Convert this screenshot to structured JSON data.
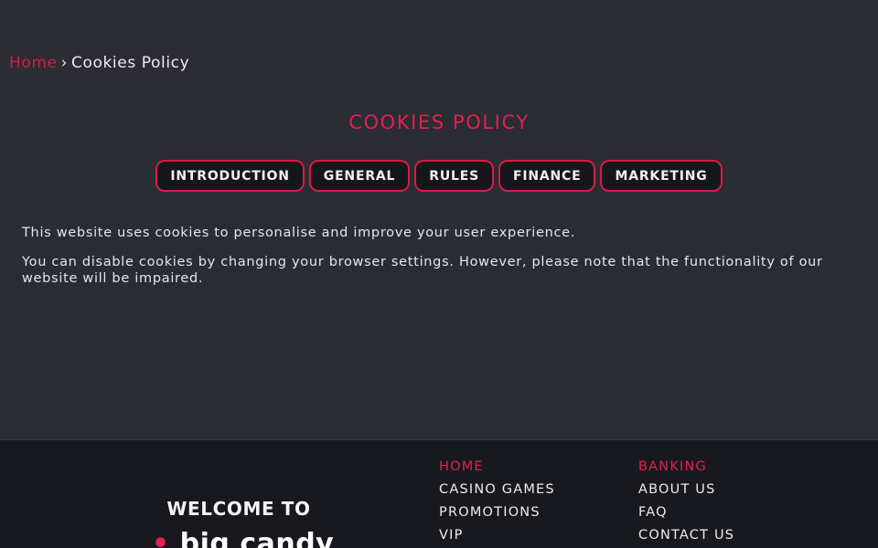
{
  "breadcrumb": {
    "home": "Home",
    "separator": "›",
    "current": "Cookies Policy"
  },
  "page_title": "COOKIES POLICY",
  "tabs": [
    {
      "label": "INTRODUCTION"
    },
    {
      "label": "GENERAL"
    },
    {
      "label": "RULES"
    },
    {
      "label": "FINANCE"
    },
    {
      "label": "MARKETING"
    }
  ],
  "content": {
    "paragraphs": [
      "This website uses cookies to personalise and improve your user experience.",
      "You can disable cookies by changing your browser settings. However, please note that the functionality of our website will be impaired."
    ]
  },
  "footer": {
    "welcome": "WELCOME TO",
    "logo_text_part1": "big candy",
    "nav_col1": [
      {
        "label": "HOME"
      },
      {
        "label": "CASINO GAMES"
      },
      {
        "label": "PROMOTIONS"
      },
      {
        "label": "VIP"
      }
    ],
    "nav_col2": [
      {
        "label": "BANKING"
      },
      {
        "label": "ABOUT US"
      },
      {
        "label": "FAQ"
      },
      {
        "label": "CONTACT US"
      }
    ]
  },
  "colors": {
    "accent": "#e0224e",
    "background": "#2a2b33",
    "footer_background": "#18191e",
    "tab_background": "#16171c"
  }
}
